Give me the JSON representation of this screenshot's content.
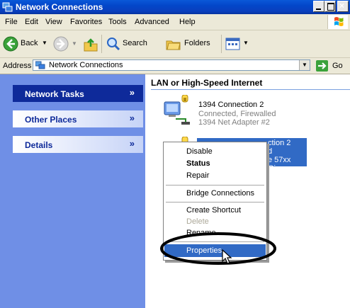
{
  "window": {
    "title": "Network Connections"
  },
  "menubar": {
    "items": [
      "File",
      "Edit",
      "View",
      "Favorites",
      "Tools",
      "Advanced",
      "Help"
    ]
  },
  "toolbar": {
    "back": "Back",
    "search": "Search",
    "folders": "Folders"
  },
  "address": {
    "label": "Address",
    "value": "Network Connections",
    "go": "Go"
  },
  "taskpane": {
    "sections": [
      "Network Tasks",
      "Other Places",
      "Details"
    ]
  },
  "content": {
    "section_title": "LAN or High-Speed Internet",
    "connections": [
      {
        "name": "1394 Connection 2",
        "status": "Connected, Firewalled",
        "device": "1394 Net Adapter #2"
      },
      {
        "name": "Local Area Connection 2",
        "status": "Connected, Firewalled",
        "device": "Intel(R) PRO/Wireless 2200BG / Broadcom NetXtreme 57xx Gig..."
      }
    ],
    "selected_visible": {
      "name_tail": "ction 2",
      "status_tail": "d",
      "device_tail": "e 57xx Gig..."
    }
  },
  "context_menu": {
    "items": [
      "Disable",
      "Status",
      "Repair",
      "Bridge Connections",
      "Create Shortcut",
      "Delete",
      "Rename",
      "Properties"
    ],
    "highlighted": "Properties"
  },
  "colors": {
    "title_bar": "#0a4bd0",
    "taskpane_bg": "#6f8fe6",
    "taskpane_head_dark": "#0e2a9a",
    "selection": "#316ac5",
    "menu_bg": "#ece9d8"
  }
}
